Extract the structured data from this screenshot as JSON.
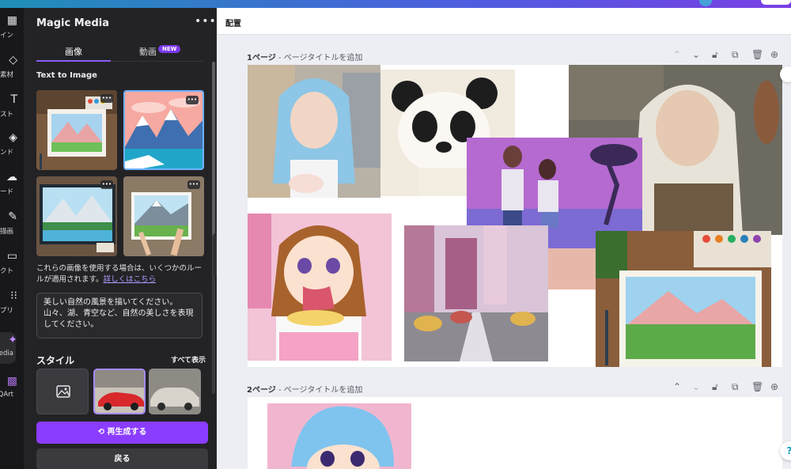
{
  "app": {
    "accent": "#8b3dff",
    "topbar_gradient": [
      "#1f8fb8",
      "#7a3fe4"
    ]
  },
  "rail": {
    "items": [
      {
        "icon": "template-icon",
        "glyph": "▦",
        "label": "ザイン"
      },
      {
        "icon": "elements-icon",
        "glyph": "◇",
        "label": "素材"
      },
      {
        "icon": "text-icon",
        "glyph": "T",
        "label": "キスト"
      },
      {
        "icon": "brand-icon",
        "glyph": "◈",
        "label": "ランド"
      },
      {
        "icon": "upload-icon",
        "glyph": "☁",
        "label": "プロード"
      },
      {
        "icon": "draw-icon",
        "glyph": "✎",
        "label": "描画"
      },
      {
        "icon": "projects-icon",
        "glyph": "▭",
        "label": "ジェクト"
      },
      {
        "icon": "apps-icon",
        "glyph": "⁝⁝",
        "label": "プリ"
      },
      {
        "icon": "magic-media-icon",
        "glyph": "✦",
        "label": "ic Media"
      },
      {
        "icon": "qr-art-icon",
        "glyph": "▩",
        "label": "o QArt"
      }
    ]
  },
  "panel": {
    "title": "Magic Media",
    "more": "•••",
    "tabs": [
      {
        "label": "画像"
      },
      {
        "label": "動画"
      }
    ],
    "new_badge": "NEW",
    "section": "Text to Image",
    "thumb_more": "•••",
    "notice_text": "これらの画像を使用する場合は、いくつかのルールが適用されます。",
    "notice_link": "詳しくはこちら",
    "prompt": "美しい自然の風景を描いてください。山々、湖、青空など、自然の美しさを表現してください。",
    "style_label": "スタイル",
    "show_all": "すべて表示",
    "regenerate": "再生成する",
    "back": "戻る"
  },
  "workspace": {
    "toolbar_label": "配置",
    "pages": [
      {
        "number": "1ページ",
        "title_placeholder": " - ページタイトルを追加"
      },
      {
        "number": "2ページ",
        "title_placeholder": " - ページタイトルを追加"
      }
    ],
    "help": "?"
  }
}
